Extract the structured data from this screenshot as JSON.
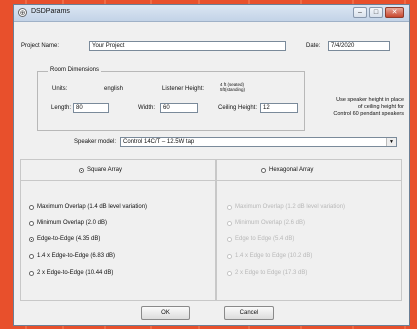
{
  "window": {
    "title": "DSDParams",
    "app_icon_glyph": "⊕",
    "controls": {
      "minimize": "–",
      "maximize": "□",
      "close": "✕"
    }
  },
  "project": {
    "name_label": "Project Name:",
    "name_value": "Your Project",
    "date_label": "Date:",
    "date_value": "7/4/2020"
  },
  "room": {
    "group_title": "Room Dimensions",
    "units_label": "Units:",
    "units_value": "english",
    "listener_label": "Listener Height:",
    "listener_value": "4 ft (seated)\n5ft(standing)",
    "length_label": "Length:",
    "length_value": "80",
    "width_label": "Width:",
    "width_value": "60",
    "ceiling_label": "Ceiling Height:",
    "ceiling_value": "12",
    "note": "Use speaker height in place\nof ceiling height for\nControl 60 pendant speakers"
  },
  "speaker": {
    "label": "Speaker model:",
    "value": "Control 14C/T – 12.5W tap",
    "dropdown_glyph": "▼"
  },
  "square": {
    "title": "Square Array",
    "options": [
      {
        "label": "Maximum Overlap (1.4 dB level variation)",
        "selected": false
      },
      {
        "label": "Minimum Overlap (2.0 dB)",
        "selected": false
      },
      {
        "label": "Edge-to-Edge (4.35 dB)",
        "selected": true
      },
      {
        "label": "1.4 x Edge-to-Edge (6.83 dB)",
        "selected": false
      },
      {
        "label": "2 x Edge-to-Edge (10.44 dB)",
        "selected": false
      }
    ]
  },
  "hexagonal": {
    "title": "Hexagonal Array",
    "options": [
      {
        "label": "Maximum Overlap (1.2 dB level variation)"
      },
      {
        "label": "Minimum Overlap (2.6 dB)"
      },
      {
        "label": "Edge to Edge (5.4 dB)"
      },
      {
        "label": "1.4 x Edge to Edge (10.2 dB)"
      },
      {
        "label": "2 x Edge to Edge (17.3 dB)"
      }
    ]
  },
  "buttons": {
    "ok": "OK",
    "cancel": "Cancel"
  },
  "colors": {
    "desktop": "#e8502c",
    "window": "#f0f0f0",
    "titlebar": "#c3d3e7",
    "disabled_text": "#b8b8b8"
  }
}
